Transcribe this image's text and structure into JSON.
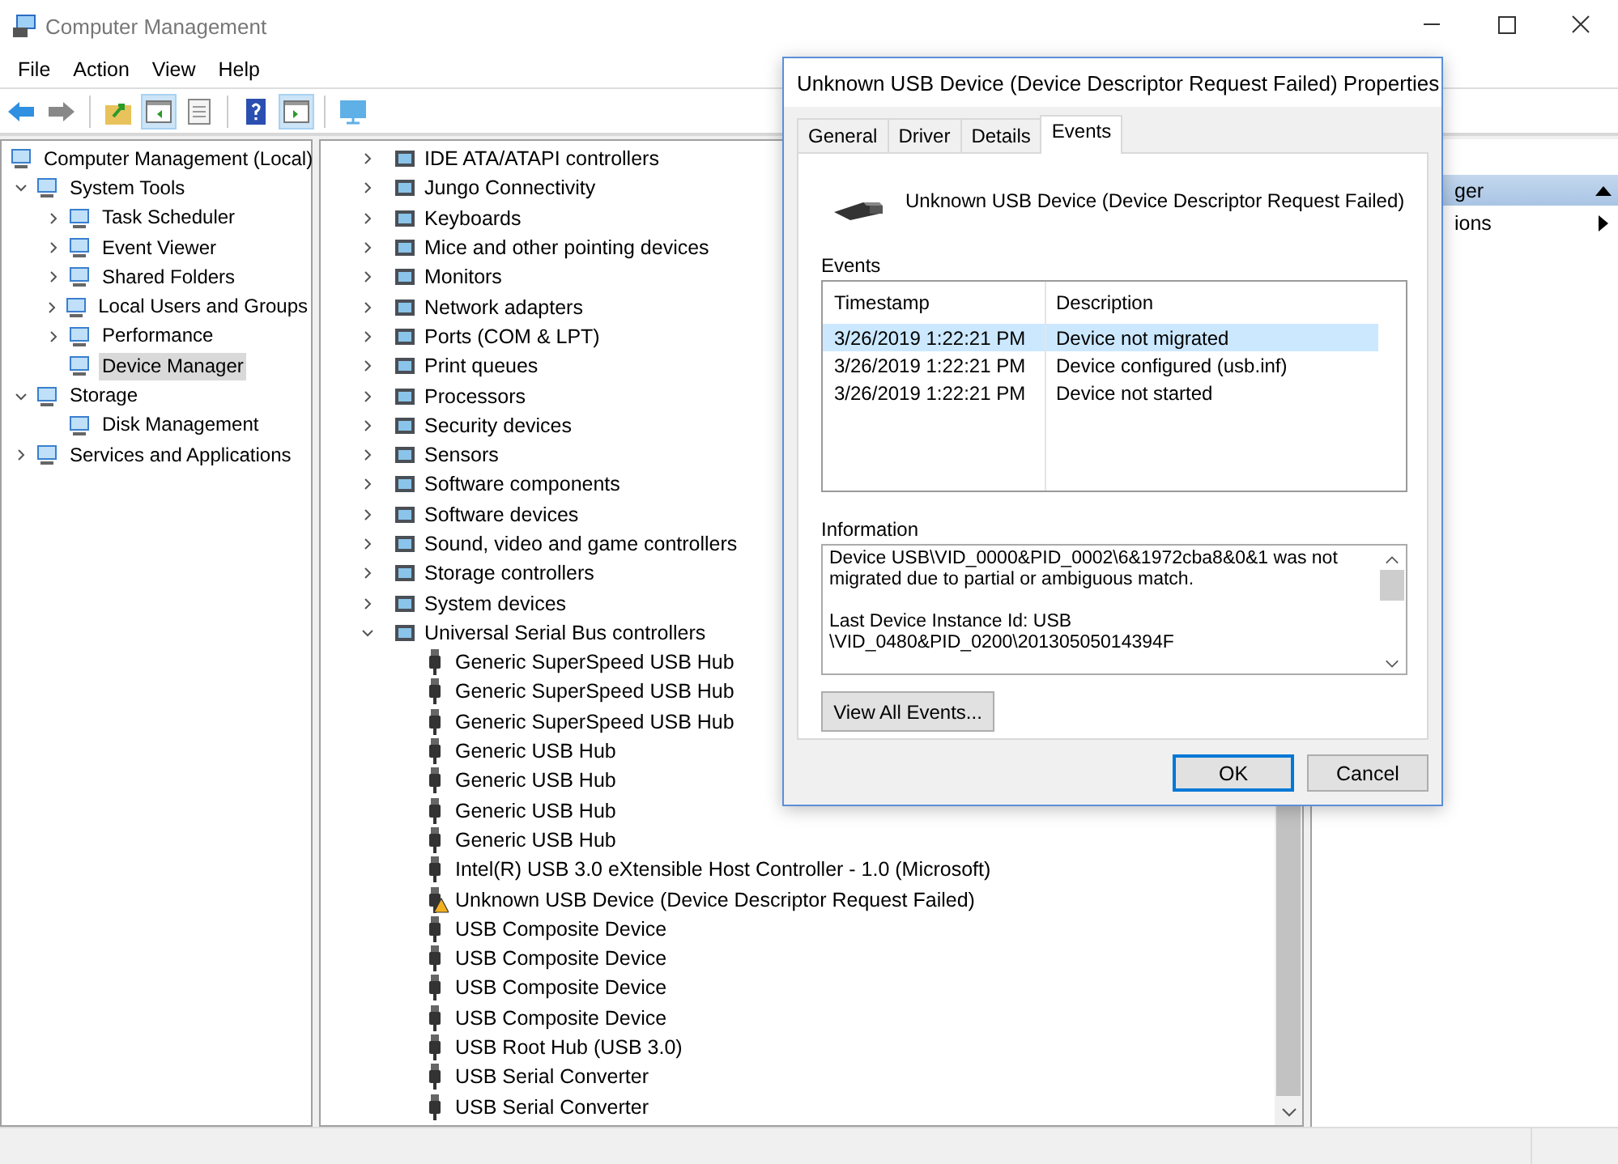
{
  "window": {
    "title": "Computer Management"
  },
  "menu": [
    "File",
    "Action",
    "View",
    "Help"
  ],
  "toolbar": [
    {
      "kind": "back",
      "pressed": false
    },
    {
      "kind": "forward",
      "pressed": false
    },
    {
      "kind": "folder-up",
      "pressed": false
    },
    {
      "kind": "console-tree",
      "pressed": true
    },
    {
      "kind": "properties",
      "pressed": false
    },
    {
      "kind": "help",
      "pressed": false
    },
    {
      "kind": "action-pane",
      "pressed": true
    },
    {
      "kind": "monitor",
      "pressed": false
    }
  ],
  "console_tree": [
    {
      "label": "Computer Management (Local)",
      "selected": false,
      "children": [
        {
          "label": "System Tools",
          "expanded": true,
          "selected": false,
          "children": [
            {
              "label": "Task Scheduler",
              "expanded": false,
              "selected": false
            },
            {
              "label": "Event Viewer",
              "expanded": false,
              "selected": false
            },
            {
              "label": "Shared Folders",
              "expanded": false,
              "selected": false
            },
            {
              "label": "Local Users and Groups",
              "expanded": false,
              "selected": false
            },
            {
              "label": "Performance",
              "expanded": false,
              "selected": false
            },
            {
              "label": "Device Manager",
              "selected": true
            }
          ]
        },
        {
          "label": "Storage",
          "expanded": true,
          "selected": false,
          "children": [
            {
              "label": "Disk Management",
              "selected": false
            }
          ]
        },
        {
          "label": "Services and Applications",
          "expanded": false,
          "selected": false
        }
      ]
    }
  ],
  "devices": [
    {
      "label": "IDE ATA/ATAPI controllers",
      "expanded": false
    },
    {
      "label": "Jungo Connectivity",
      "expanded": false
    },
    {
      "label": "Keyboards",
      "expanded": false
    },
    {
      "label": "Mice and other pointing devices",
      "expanded": false
    },
    {
      "label": "Monitors",
      "expanded": false
    },
    {
      "label": "Network adapters",
      "expanded": false
    },
    {
      "label": "Ports (COM & LPT)",
      "expanded": false
    },
    {
      "label": "Print queues",
      "expanded": false
    },
    {
      "label": "Processors",
      "expanded": false
    },
    {
      "label": "Security devices",
      "expanded": false
    },
    {
      "label": "Sensors",
      "expanded": false
    },
    {
      "label": "Software components",
      "expanded": false
    },
    {
      "label": "Software devices",
      "expanded": false
    },
    {
      "label": "Sound, video and game controllers",
      "expanded": false
    },
    {
      "label": "Storage controllers",
      "expanded": false
    },
    {
      "label": "System devices",
      "expanded": false
    },
    {
      "label": "Universal Serial Bus controllers",
      "expanded": true,
      "children": [
        {
          "label": "Generic SuperSpeed USB Hub",
          "warning": false
        },
        {
          "label": "Generic SuperSpeed USB Hub",
          "warning": false
        },
        {
          "label": "Generic SuperSpeed USB Hub",
          "warning": false
        },
        {
          "label": "Generic USB Hub",
          "warning": false
        },
        {
          "label": "Generic USB Hub",
          "warning": false
        },
        {
          "label": "Generic USB Hub",
          "warning": false
        },
        {
          "label": "Generic USB Hub",
          "warning": false
        },
        {
          "label": "Intel(R) USB 3.0 eXtensible Host Controller - 1.0 (Microsoft)",
          "warning": false
        },
        {
          "label": "Unknown USB Device (Device Descriptor Request Failed)",
          "warning": true
        },
        {
          "label": "USB Composite Device",
          "warning": false
        },
        {
          "label": "USB Composite Device",
          "warning": false
        },
        {
          "label": "USB Composite Device",
          "warning": false
        },
        {
          "label": "USB Composite Device",
          "warning": false
        },
        {
          "label": "USB Root Hub (USB 3.0)",
          "warning": false
        },
        {
          "label": "USB Serial Converter",
          "warning": false
        },
        {
          "label": "USB Serial Converter",
          "warning": false
        }
      ]
    }
  ],
  "actions": [
    {
      "label": "ger",
      "kind": "header"
    },
    {
      "label": "ions",
      "kind": "submenu"
    }
  ],
  "dialog": {
    "title": "Unknown USB Device (Device Descriptor Request Failed) Properties",
    "tabs": [
      {
        "label": "General",
        "selected": false
      },
      {
        "label": "Driver",
        "selected": false
      },
      {
        "label": "Details",
        "selected": false
      },
      {
        "label": "Events",
        "selected": true
      }
    ],
    "device_name": "Unknown USB Device (Device Descriptor Request Failed)",
    "events_label": "Events",
    "columns": [
      "Timestamp",
      "Description"
    ],
    "rows": [
      {
        "timestamp": "3/26/2019 1:22:21 PM",
        "description": "Device not migrated",
        "selected": true
      },
      {
        "timestamp": "3/26/2019 1:22:21 PM",
        "description": "Device configured (usb.inf)",
        "selected": false
      },
      {
        "timestamp": "3/26/2019 1:22:21 PM",
        "description": "Device not started",
        "selected": false
      }
    ],
    "information_label": "Information",
    "information": [
      [
        "Device USB\\VID_0000&PID_0002\\6&1972cba8&0&1 was not",
        "migrated due to partial or ambiguous match."
      ],
      [
        "Last Device Instance Id: USB",
        "\\VID_0480&PID_0200\\20130505014394F"
      ]
    ],
    "view_all_button": "View All Events...",
    "buttons": [
      {
        "label": "OK",
        "default": true
      },
      {
        "label": "Cancel",
        "default": false
      }
    ]
  }
}
